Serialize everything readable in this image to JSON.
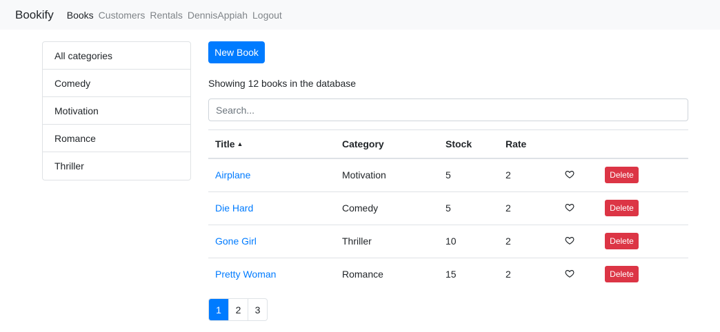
{
  "navbar": {
    "brand": "Bookify",
    "links": [
      {
        "label": "Books",
        "active": true
      },
      {
        "label": "Customers"
      },
      {
        "label": "Rentals"
      },
      {
        "label": "DennisAppiah"
      },
      {
        "label": "Logout"
      }
    ]
  },
  "sidebar": {
    "categories": [
      "All categories",
      "Comedy",
      "Motivation",
      "Romance",
      "Thriller"
    ]
  },
  "main": {
    "new_book_label": "New Book",
    "summary": "Showing 12 books in the database",
    "search_placeholder": "Search...",
    "table": {
      "headers": {
        "title": "Title",
        "category": "Category",
        "stock": "Stock",
        "rate": "Rate"
      },
      "sort_indicator": "▲",
      "delete_label": "Delete",
      "rows": [
        {
          "title": "Airplane",
          "category": "Motivation",
          "stock": "5",
          "rate": "2"
        },
        {
          "title": "Die Hard",
          "category": "Comedy",
          "stock": "5",
          "rate": "2"
        },
        {
          "title": "Gone Girl",
          "category": "Thriller",
          "stock": "10",
          "rate": "2"
        },
        {
          "title": "Pretty Woman",
          "category": "Romance",
          "stock": "15",
          "rate": "2"
        }
      ]
    },
    "pagination": {
      "pages": [
        "1",
        "2",
        "3"
      ],
      "current": "1"
    }
  },
  "colors": {
    "primary": "#007bff",
    "danger": "#dc3545",
    "navbar_bg": "#f8f9fa"
  }
}
